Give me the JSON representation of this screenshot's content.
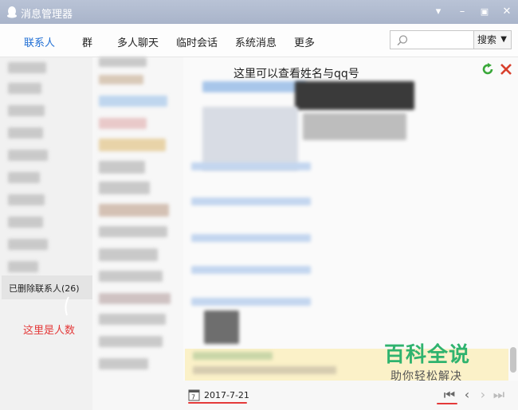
{
  "window": {
    "title": "消息管理器",
    "icon": "qq-penguin-icon",
    "controls": [
      "dropdown-icon",
      "minimize-icon",
      "maximize-icon",
      "close-icon"
    ]
  },
  "tabs": [
    {
      "label": "联系人",
      "active": true
    },
    {
      "label": "群",
      "active": false
    },
    {
      "label": "多人聊天",
      "active": false
    },
    {
      "label": "临时会话",
      "active": false
    },
    {
      "label": "系统消息",
      "active": false
    },
    {
      "label": "更多",
      "active": false
    }
  ],
  "search": {
    "placeholder": "",
    "button_label": "搜索"
  },
  "left_panel": {
    "deleted_contacts_label": "已删除联系人(26)",
    "annotation": "这里是人数"
  },
  "right_panel": {
    "annotation": "这里可以查看姓名与qq号",
    "actions": [
      "refresh-icon",
      "delete-icon"
    ]
  },
  "footer": {
    "date": "2017-7-21",
    "nav": [
      "first-page-icon",
      "prev-page-icon",
      "next-page-icon",
      "last-page-icon"
    ]
  },
  "watermark": {
    "main": "百科全说",
    "sub": "助你轻松解决"
  },
  "colors": {
    "accent": "#1f6ed4",
    "annotation": "#e43a3a",
    "watermark": "#2fb36e"
  }
}
